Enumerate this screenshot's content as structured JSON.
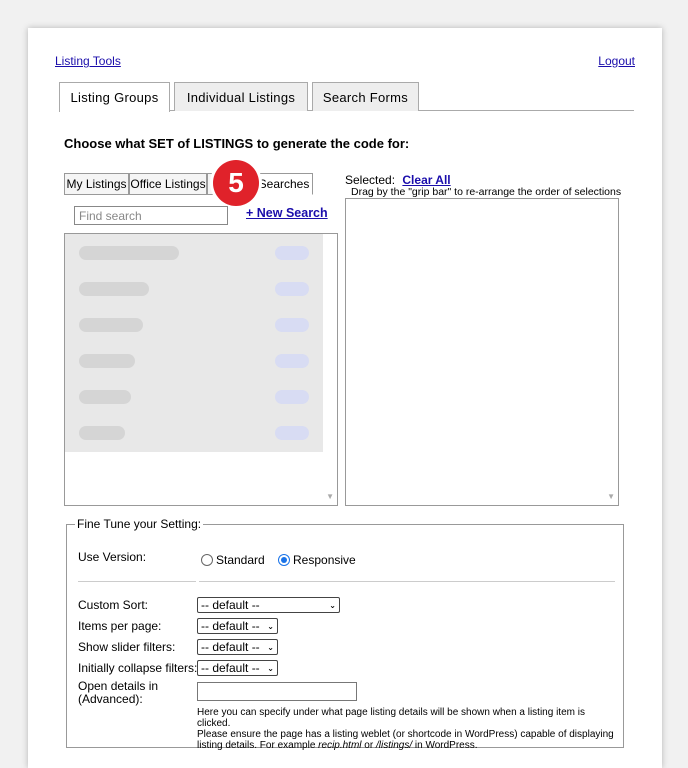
{
  "header": {
    "listing_tools": "Listing Tools",
    "logout": "Logout"
  },
  "main_tabs": [
    {
      "label": "Listing Groups",
      "active": true
    },
    {
      "label": "Individual Listings",
      "active": false
    },
    {
      "label": "Search Forms",
      "active": false
    }
  ],
  "heading": "Choose what SET of LISTINGS to generate the code for:",
  "sub_tabs": [
    {
      "label": "My Listings"
    },
    {
      "label": "Office Listings"
    },
    {
      "label": "Searches"
    }
  ],
  "step_badge": "5",
  "search": {
    "placeholder": "Find search",
    "new_search": "+ New Search"
  },
  "selected": {
    "label": "Selected:",
    "clear_all": "Clear All",
    "drag_note": "Drag by the \"grip bar\" to re-arrange the order of selections"
  },
  "fine_tune": {
    "legend": "Fine Tune your Setting:",
    "use_version_label": "Use Version:",
    "standard": "Standard",
    "responsive": "Responsive",
    "version_selected": "Responsive",
    "custom_sort_label": "Custom Sort:",
    "items_per_page_label": "Items per page:",
    "show_slider_label": "Show slider filters:",
    "collapse_filters_label": "Initially collapse filters:",
    "open_details_label_1": "Open details in",
    "open_details_label_2": "(Advanced):",
    "default_option": "-- default --",
    "help_1": "Here you can specify under what page listing details will be shown when a listing item is clicked.",
    "help_2": "Please ensure the page has a listing weblet (or shortcode in WordPress) capable of displaying",
    "help_3a": "listing details. For example ",
    "help_3b": "recip.html",
    "help_3c": " or ",
    "help_3d": "/listings/",
    "help_3e": " in WordPress."
  },
  "colors": {
    "link": "#1a0dab",
    "badge": "#e0222a",
    "radio_on": "#1a73e8"
  }
}
